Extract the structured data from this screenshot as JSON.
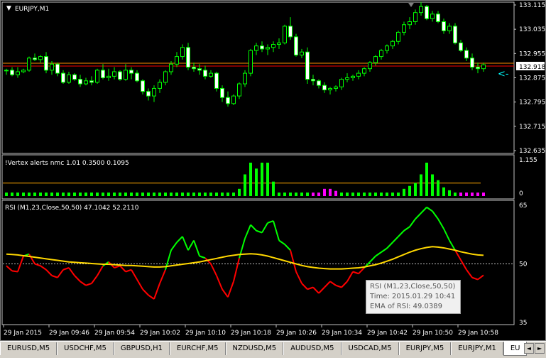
{
  "main_chart": {
    "title": "EURJPY,M1",
    "price_ticks": [
      "133.115",
      "133.035",
      "132.955",
      "132.875",
      "132.795",
      "132.715",
      "132.635"
    ],
    "current_price": "132.918",
    "price_arrow": "<-"
  },
  "vertex": {
    "label": "!Vertex alerts nmc 1.01 0.3500 0.1095",
    "ticks": [
      "1.155",
      "0"
    ]
  },
  "rsi": {
    "label": "RSI (M1,23,Close,50,50) 47.1042 52.2110",
    "ticks": [
      "65",
      "50",
      "35"
    ]
  },
  "time_axis": [
    "29 Jan 2015",
    "29 Jan 09:46",
    "29 Jan 09:54",
    "29 Jan 10:02",
    "29 Jan 10:10",
    "29 Jan 10:18",
    "29 Jan 10:26",
    "29 Jan 10:34",
    "29 Jan 10:42",
    "29 Jan 10:50",
    "29 Jan 10:58"
  ],
  "tooltip": {
    "line1": "RSI (M1,23,Close,50,50)",
    "line2": "Time: 2015.01.29 10:41",
    "line3": "EMA of RSI: 49.0389"
  },
  "tabs": [
    "EURUSD,M5",
    "USDCHF,M5",
    "GBPUSD,H1",
    "EURCHF,M5",
    "NZDUSD,M5",
    "AUDUSD,M5",
    "USDCAD,M5",
    "EURJPY,M5",
    "EURJPY,M1",
    "EU"
  ],
  "colors": {
    "background": "#000000",
    "bull_candle": "#00ff00",
    "bear_candle": "#00ff00",
    "bid_line": "#ff0000",
    "ask_line": "#ff8c00",
    "vertex_up": "#00ff00",
    "vertex_down": "#ff00ff",
    "vertex_level": "#ffa500",
    "rsi_up": "#00ff00",
    "rsi_down": "#ff0000",
    "ema": "#ffd700"
  },
  "candles": [
    [
      132.9,
      132.905,
      132.885,
      132.9
    ],
    [
      132.9,
      132.91,
      132.88,
      132.885
    ],
    [
      132.885,
      132.91,
      132.875,
      132.895
    ],
    [
      132.895,
      132.905,
      132.89,
      132.9
    ],
    [
      132.9,
      132.945,
      132.895,
      132.94
    ],
    [
      132.94,
      132.955,
      132.93,
      132.935
    ],
    [
      132.935,
      132.95,
      132.925,
      132.945
    ],
    [
      132.945,
      132.96,
      132.89,
      132.9
    ],
    [
      132.9,
      132.93,
      132.885,
      132.92
    ],
    [
      132.92,
      132.925,
      132.88,
      132.89
    ],
    [
      132.89,
      132.9,
      132.855,
      132.86
    ],
    [
      132.86,
      132.895,
      132.855,
      132.885
    ],
    [
      132.885,
      132.89,
      132.865,
      132.87
    ],
    [
      132.87,
      132.885,
      132.845,
      132.855
    ],
    [
      132.855,
      132.875,
      132.85,
      132.865
    ],
    [
      132.865,
      132.88,
      132.85,
      132.86
    ],
    [
      132.86,
      132.905,
      132.855,
      132.9
    ],
    [
      132.9,
      132.92,
      132.87,
      132.875
    ],
    [
      132.875,
      132.905,
      132.865,
      132.88
    ],
    [
      132.88,
      132.91,
      132.87,
      132.895
    ],
    [
      132.895,
      132.9,
      132.865,
      132.87
    ],
    [
      132.87,
      132.92,
      132.865,
      132.9
    ],
    [
      132.9,
      132.91,
      132.87,
      132.89
    ],
    [
      132.89,
      132.9,
      132.86,
      132.865
    ],
    [
      132.865,
      132.87,
      132.82,
      132.83
    ],
    [
      132.83,
      132.84,
      132.8,
      132.815
    ],
    [
      132.815,
      132.85,
      132.795,
      132.84
    ],
    [
      132.84,
      132.87,
      132.825,
      132.86
    ],
    [
      132.86,
      132.9,
      132.85,
      132.895
    ],
    [
      132.895,
      132.93,
      132.885,
      132.92
    ],
    [
      132.92,
      132.96,
      132.91,
      132.945
    ],
    [
      132.945,
      132.985,
      132.935,
      132.975
    ],
    [
      132.975,
      132.99,
      132.9,
      132.91
    ],
    [
      132.91,
      132.925,
      132.895,
      132.905
    ],
    [
      132.905,
      132.92,
      132.885,
      132.9
    ],
    [
      132.9,
      132.915,
      132.87,
      132.88
    ],
    [
      132.88,
      132.9,
      132.875,
      132.89
    ],
    [
      132.89,
      132.895,
      132.83,
      132.84
    ],
    [
      132.84,
      132.85,
      132.795,
      132.81
    ],
    [
      132.81,
      132.83,
      132.78,
      132.79
    ],
    [
      132.79,
      132.82,
      132.785,
      132.815
    ],
    [
      132.815,
      132.86,
      132.805,
      132.855
    ],
    [
      132.855,
      132.9,
      132.845,
      132.89
    ],
    [
      132.89,
      132.97,
      132.88,
      132.965
    ],
    [
      132.965,
      132.99,
      132.95,
      132.98
    ],
    [
      132.98,
      132.995,
      132.96,
      132.97
    ],
    [
      132.97,
      132.985,
      132.95,
      132.975
    ],
    [
      132.975,
      132.995,
      132.96,
      132.985
    ],
    [
      132.985,
      133.005,
      132.97,
      132.99
    ],
    [
      132.99,
      133.05,
      132.985,
      133.045
    ],
    [
      133.045,
      133.075,
      133.0,
      133.01
    ],
    [
      133.01,
      133.02,
      132.945,
      132.95
    ],
    [
      132.95,
      132.97,
      132.94,
      132.96
    ],
    [
      132.96,
      132.975,
      132.855,
      132.87
    ],
    [
      132.87,
      132.885,
      132.85,
      132.865
    ],
    [
      132.865,
      132.87,
      132.84,
      132.85
    ],
    [
      132.85,
      132.86,
      132.825,
      132.835
    ],
    [
      132.835,
      132.845,
      132.82,
      132.84
    ],
    [
      132.84,
      132.85,
      132.83,
      132.845
    ],
    [
      132.845,
      132.875,
      132.835,
      132.87
    ],
    [
      132.87,
      132.89,
      132.86,
      132.875
    ],
    [
      132.875,
      132.885,
      132.865,
      132.88
    ],
    [
      132.88,
      132.9,
      132.87,
      132.89
    ],
    [
      132.89,
      132.91,
      132.88,
      132.905
    ],
    [
      132.905,
      132.93,
      132.895,
      132.925
    ],
    [
      132.925,
      132.95,
      132.915,
      132.945
    ],
    [
      132.945,
      132.97,
      132.935,
      132.965
    ],
    [
      132.965,
      132.985,
      132.955,
      132.98
    ],
    [
      132.98,
      133.0,
      132.97,
      132.995
    ],
    [
      132.995,
      133.03,
      132.985,
      133.025
    ],
    [
      133.025,
      133.06,
      133.015,
      133.05
    ],
    [
      133.05,
      133.075,
      133.035,
      133.06
    ],
    [
      133.06,
      133.1,
      133.05,
      133.09
    ],
    [
      133.09,
      133.125,
      133.08,
      133.11
    ],
    [
      133.11,
      133.115,
      133.065,
      133.07
    ],
    [
      133.07,
      133.095,
      133.06,
      133.085
    ],
    [
      133.085,
      133.095,
      133.055,
      133.06
    ],
    [
      133.06,
      133.07,
      133.02,
      133.03
    ],
    [
      133.03,
      133.055,
      133.02,
      133.045
    ],
    [
      133.045,
      133.055,
      132.985,
      132.99
    ],
    [
      132.99,
      133.0,
      132.96,
      132.965
    ],
    [
      132.965,
      132.975,
      132.93,
      132.94
    ],
    [
      132.94,
      132.955,
      132.9,
      132.91
    ],
    [
      132.91,
      132.925,
      132.89,
      132.905
    ],
    [
      132.905,
      132.925,
      132.895,
      132.918
    ]
  ],
  "vertex_bars": [
    0.12,
    0.12,
    0.12,
    0.12,
    0.12,
    0.12,
    0.12,
    0.12,
    0.12,
    0.12,
    0.12,
    0.12,
    0.12,
    0.12,
    0.12,
    0.12,
    0.12,
    0.12,
    0.12,
    0.12,
    0.12,
    0.12,
    0.12,
    0.12,
    0.12,
    0.12,
    0.12,
    0.12,
    0.12,
    0.12,
    0.12,
    0.12,
    0.12,
    0.12,
    0.12,
    0.12,
    0.12,
    0.12,
    0.12,
    0.12,
    0.12,
    0.25,
    0.75,
    1.155,
    0.95,
    1.155,
    1.155,
    0.5,
    0.12,
    0.12,
    0.12,
    0.12,
    0.12,
    0.12,
    -0.12,
    -0.12,
    -0.25,
    -0.25,
    -0.18,
    0.12,
    0.12,
    0.12,
    0.12,
    0.12,
    0.12,
    0.12,
    0.12,
    0.12,
    0.12,
    0.12,
    0.25,
    0.35,
    0.45,
    0.75,
    1.155,
    0.75,
    0.55,
    0.3,
    0.2,
    0.12,
    -0.12,
    -0.12,
    -0.12,
    -0.12,
    -0.12
  ],
  "vertex_level": 0.35,
  "rsi_values": [
    49.5,
    48.2,
    48.0,
    52.0,
    52.5,
    50.0,
    49.5,
    48.5,
    47.0,
    46.5,
    48.5,
    49.0,
    47.0,
    45.5,
    44.5,
    45.0,
    47.0,
    49.5,
    50.5,
    49.0,
    49.5,
    48.0,
    48.5,
    46.0,
    43.5,
    42.0,
    41.0,
    45.0,
    48.5,
    53.5,
    55.5,
    57.0,
    53.5,
    56.0,
    52.0,
    51.5,
    50.0,
    47.0,
    43.5,
    41.5,
    45.5,
    51.5,
    56.5,
    60.0,
    58.5,
    58.0,
    60.5,
    61.0,
    56.0,
    55.0,
    53.5,
    48.0,
    45.0,
    43.5,
    44.0,
    42.5,
    44.0,
    45.5,
    44.5,
    44.0,
    45.5,
    48.0,
    47.5,
    49.0,
    50.5,
    52.0,
    53.0,
    54.0,
    55.5,
    57.0,
    58.5,
    59.5,
    61.5,
    63.0,
    64.5,
    63.5,
    61.5,
    59.0,
    56.0,
    53.5,
    51.0,
    48.5,
    46.5,
    46.0,
    47.1
  ],
  "ema_values": [
    52.5,
    52.4,
    52.3,
    52.1,
    51.9,
    51.7,
    51.5,
    51.3,
    51.1,
    50.9,
    50.7,
    50.5,
    50.4,
    50.3,
    50.2,
    50.1,
    50.0,
    49.9,
    49.9,
    49.8,
    49.7,
    49.6,
    49.6,
    49.5,
    49.4,
    49.3,
    49.2,
    49.2,
    49.3,
    49.5,
    49.7,
    49.9,
    50.1,
    50.3,
    50.5,
    50.8,
    51.1,
    51.4,
    51.7,
    52.0,
    52.2,
    52.4,
    52.5,
    52.6,
    52.5,
    52.3,
    52.0,
    51.6,
    51.2,
    50.8,
    50.4,
    50.0,
    49.6,
    49.3,
    49.1,
    48.9,
    48.8,
    48.7,
    48.7,
    48.7,
    48.8,
    48.9,
    49.0,
    49.2,
    49.5,
    49.8,
    50.2,
    50.7,
    51.2,
    51.8,
    52.4,
    53.0,
    53.5,
    53.9,
    54.2,
    54.4,
    54.3,
    54.1,
    53.8,
    53.5,
    53.1,
    52.8,
    52.5,
    52.3,
    52.2
  ]
}
